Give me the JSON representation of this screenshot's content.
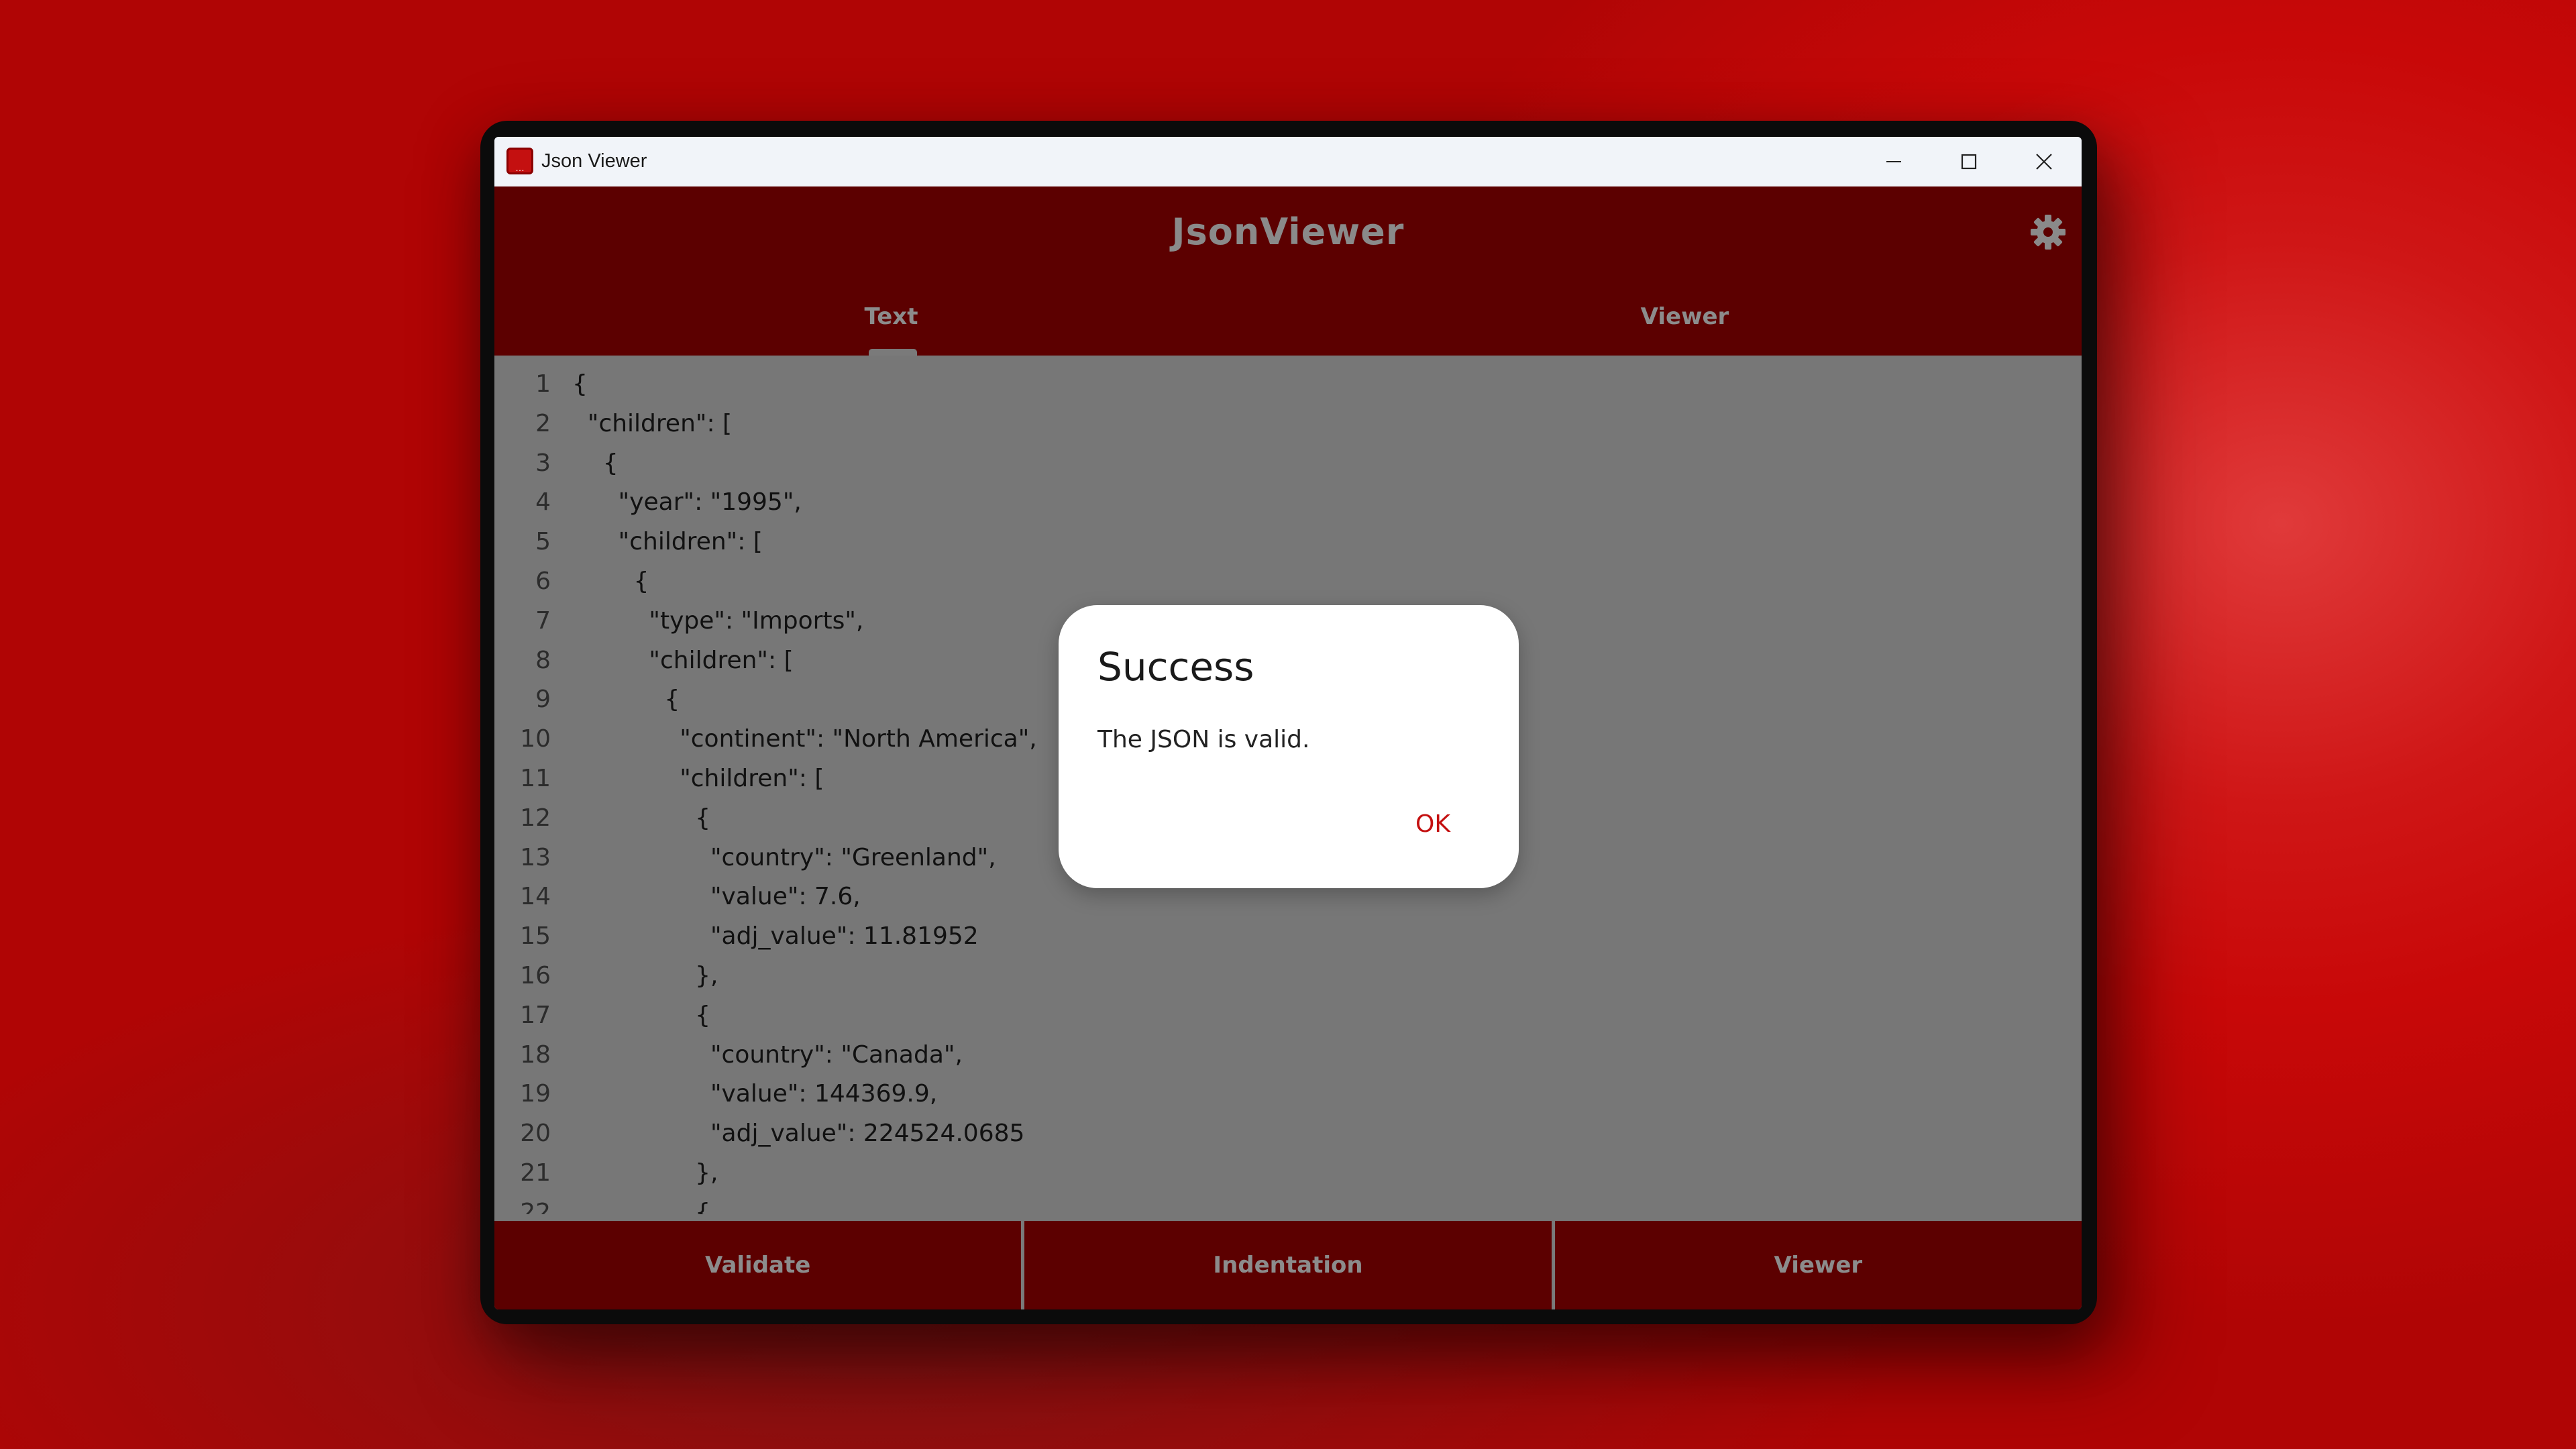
{
  "window": {
    "title": "Json Viewer",
    "controls": {
      "minimize": "—",
      "maximize": "☐",
      "close": "✕"
    }
  },
  "app": {
    "title": "JsonViewer",
    "settings_icon": "gear-icon",
    "tabs": [
      {
        "label": "Text",
        "selected": true
      },
      {
        "label": "Viewer",
        "selected": false
      }
    ]
  },
  "editor": {
    "lines": [
      {
        "n": "1",
        "text": "{"
      },
      {
        "n": "2",
        "text": "  \"children\": ["
      },
      {
        "n": "3",
        "text": "    {"
      },
      {
        "n": "4",
        "text": "      \"year\": \"1995\","
      },
      {
        "n": "5",
        "text": "      \"children\": ["
      },
      {
        "n": "6",
        "text": "        {"
      },
      {
        "n": "7",
        "text": "          \"type\": \"Imports\","
      },
      {
        "n": "8",
        "text": "          \"children\": ["
      },
      {
        "n": "9",
        "text": "            {"
      },
      {
        "n": "10",
        "text": "              \"continent\": \"North America\","
      },
      {
        "n": "11",
        "text": "              \"children\": ["
      },
      {
        "n": "12",
        "text": "                {"
      },
      {
        "n": "13",
        "text": "                  \"country\": \"Greenland\","
      },
      {
        "n": "14",
        "text": "                  \"value\": 7.6,"
      },
      {
        "n": "15",
        "text": "                  \"adj_value\": 11.81952"
      },
      {
        "n": "16",
        "text": "                },"
      },
      {
        "n": "17",
        "text": "                {"
      },
      {
        "n": "18",
        "text": "                  \"country\": \"Canada\","
      },
      {
        "n": "19",
        "text": "                  \"value\": 144369.9,"
      },
      {
        "n": "20",
        "text": "                  \"adj_value\": 224524.0685"
      },
      {
        "n": "21",
        "text": "                },"
      },
      {
        "n": "22",
        "text": "                {"
      }
    ]
  },
  "bottom_bar": {
    "validate": "Validate",
    "indentation": "Indentation",
    "viewer": "Viewer"
  },
  "dialog": {
    "title": "Success",
    "message": "The JSON is valid.",
    "ok": "OK"
  },
  "colors": {
    "header": "#5c0000",
    "accent": "#c41010",
    "editor_bg": "#777777"
  }
}
